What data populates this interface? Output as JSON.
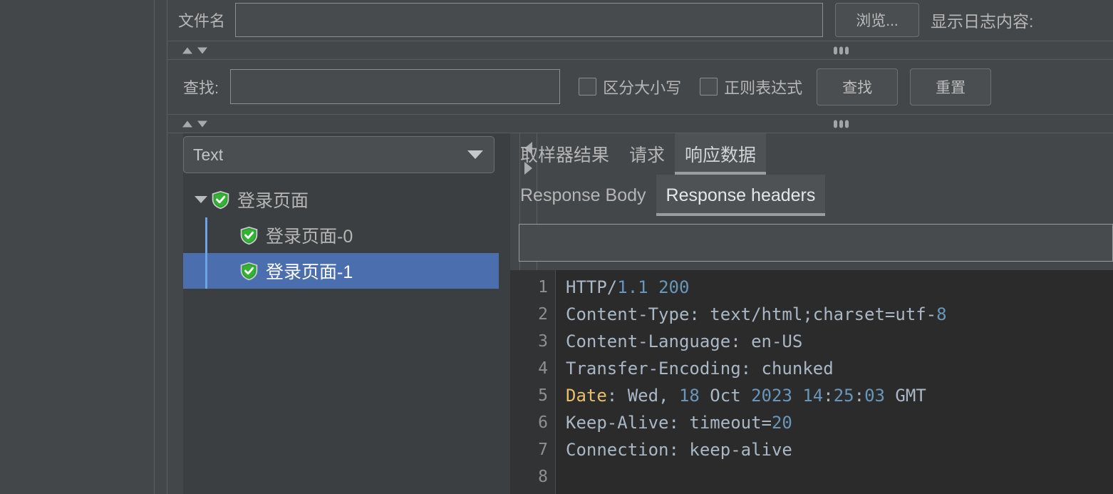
{
  "file_row": {
    "label": "文件名",
    "input_value": "",
    "input_placeholder": "",
    "browse_label": "浏览...",
    "log_label": "显示日志内容:"
  },
  "find_row": {
    "label": "查找:",
    "input_value": "",
    "input_placeholder": "",
    "case_sensitive_label": "区分大小写",
    "case_sensitive_checked": false,
    "regex_label": "正则表达式",
    "regex_checked": false,
    "find_button": "查找",
    "reset_button": "重置"
  },
  "tree_pane": {
    "combo_value": "Text",
    "nodes": [
      {
        "label": "登录页面",
        "level": 0,
        "expanded": true,
        "selected": false,
        "icon": "green-shield-check-icon"
      },
      {
        "label": "登录页面-0",
        "level": 1,
        "expanded": false,
        "selected": false,
        "icon": "green-shield-check-icon"
      },
      {
        "label": "登录页面-1",
        "level": 1,
        "expanded": false,
        "selected": true,
        "icon": "green-shield-check-icon"
      }
    ]
  },
  "right_pane": {
    "main_tabs": [
      {
        "label": "取样器结果",
        "active": false
      },
      {
        "label": "请求",
        "active": false
      },
      {
        "label": "响应数据",
        "active": true
      }
    ],
    "sub_tabs": [
      {
        "label": "Response Body",
        "active": false
      },
      {
        "label": "Response headers",
        "active": true
      }
    ],
    "search_value": "",
    "search_placeholder": "",
    "code": {
      "line_numbers": [
        "1",
        "2",
        "3",
        "4",
        "5",
        "6",
        "7",
        "8"
      ],
      "lines": [
        [
          {
            "t": "HTTP/",
            "c": "plain"
          },
          {
            "t": "1.1",
            "c": "num"
          },
          {
            "t": " ",
            "c": "plain"
          },
          {
            "t": "200",
            "c": "num"
          }
        ],
        [
          {
            "t": "Content-Type: text/html;charset=utf-",
            "c": "plain"
          },
          {
            "t": "8",
            "c": "num"
          }
        ],
        [
          {
            "t": "Content-Language: en-US",
            "c": "plain"
          }
        ],
        [
          {
            "t": "Transfer-Encoding: chunked",
            "c": "plain"
          }
        ],
        [
          {
            "t": "Date",
            "c": "key"
          },
          {
            "t": ": Wed, ",
            "c": "plain"
          },
          {
            "t": "18",
            "c": "num"
          },
          {
            "t": " Oct ",
            "c": "plain"
          },
          {
            "t": "2023",
            "c": "num"
          },
          {
            "t": " ",
            "c": "plain"
          },
          {
            "t": "14",
            "c": "num"
          },
          {
            "t": ":",
            "c": "plain"
          },
          {
            "t": "25",
            "c": "num"
          },
          {
            "t": ":",
            "c": "plain"
          },
          {
            "t": "03",
            "c": "num"
          },
          {
            "t": " GMT",
            "c": "plain"
          }
        ],
        [
          {
            "t": "Keep-Alive: timeout=",
            "c": "plain"
          },
          {
            "t": "20",
            "c": "num"
          }
        ],
        [
          {
            "t": "Connection: keep-alive",
            "c": "plain"
          }
        ],
        [
          {
            "t": "",
            "c": "plain"
          }
        ]
      ]
    }
  },
  "colors": {
    "background": "#43474a",
    "panel": "#3c3f41",
    "selection_blue": "#4b6eaf",
    "tree_guide": "#6ba5e7",
    "code_background": "#2b2b2b",
    "code_text": "#a9b7c6",
    "code_number": "#6897bb",
    "code_keyword": "#e8bf6a",
    "shield_green": "#2aa02a"
  }
}
